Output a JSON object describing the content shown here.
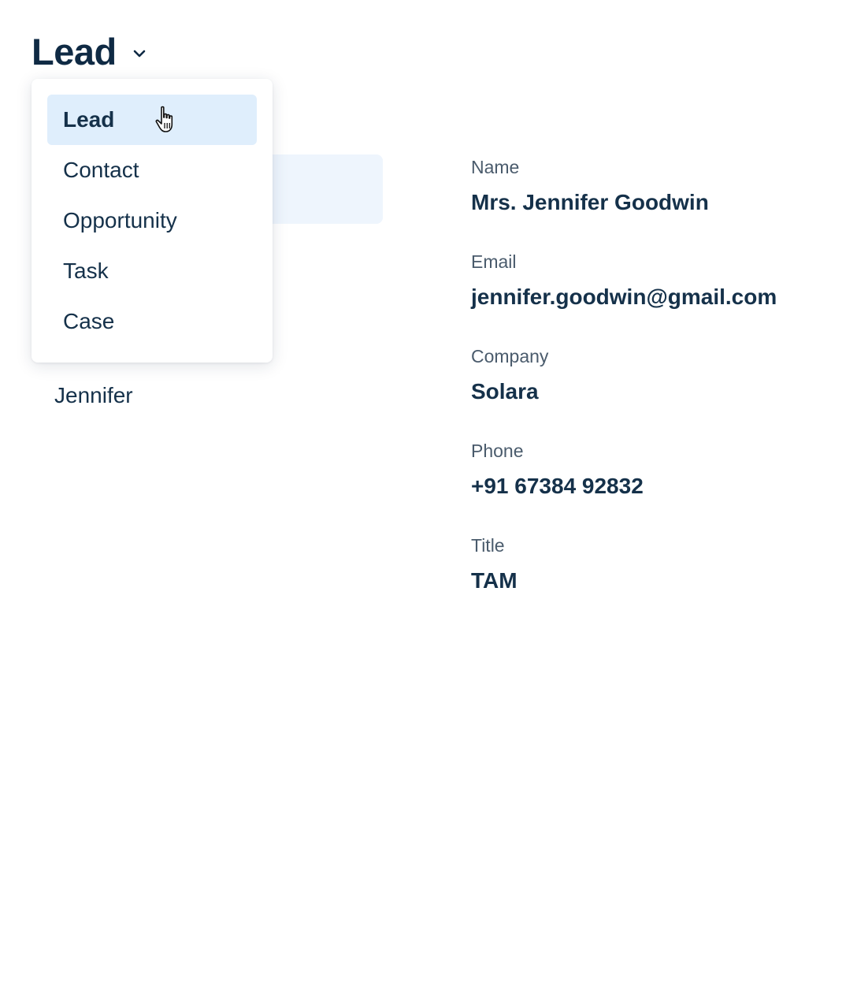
{
  "header": {
    "record_type": "Lead"
  },
  "dropdown": {
    "items": [
      {
        "label": "Lead"
      },
      {
        "label": "Contact"
      },
      {
        "label": "Opportunity"
      },
      {
        "label": "Task"
      },
      {
        "label": "Case"
      }
    ],
    "selected": "Lead"
  },
  "list": {
    "visible_item_name": "Jennifer"
  },
  "details": {
    "fields": [
      {
        "label": "Name",
        "value": "Mrs. Jennifer Goodwin"
      },
      {
        "label": "Email",
        "value": "jennifer.goodwin@gmail.com"
      },
      {
        "label": "Company",
        "value": "Solara"
      },
      {
        "label": "Phone",
        "value": "+91 67384 92832"
      },
      {
        "label": "Title",
        "value": "TAM"
      }
    ]
  },
  "colors": {
    "text_primary": "#15314a",
    "heading": "#0f2a44",
    "label": "#4a5b6c",
    "active_item_bg": "#dfeefc",
    "list_highlight_bg": "#eef5fd"
  },
  "icons": {
    "dropdown_toggle": "chevron-down-icon",
    "pointer": "hand-cursor-icon"
  }
}
